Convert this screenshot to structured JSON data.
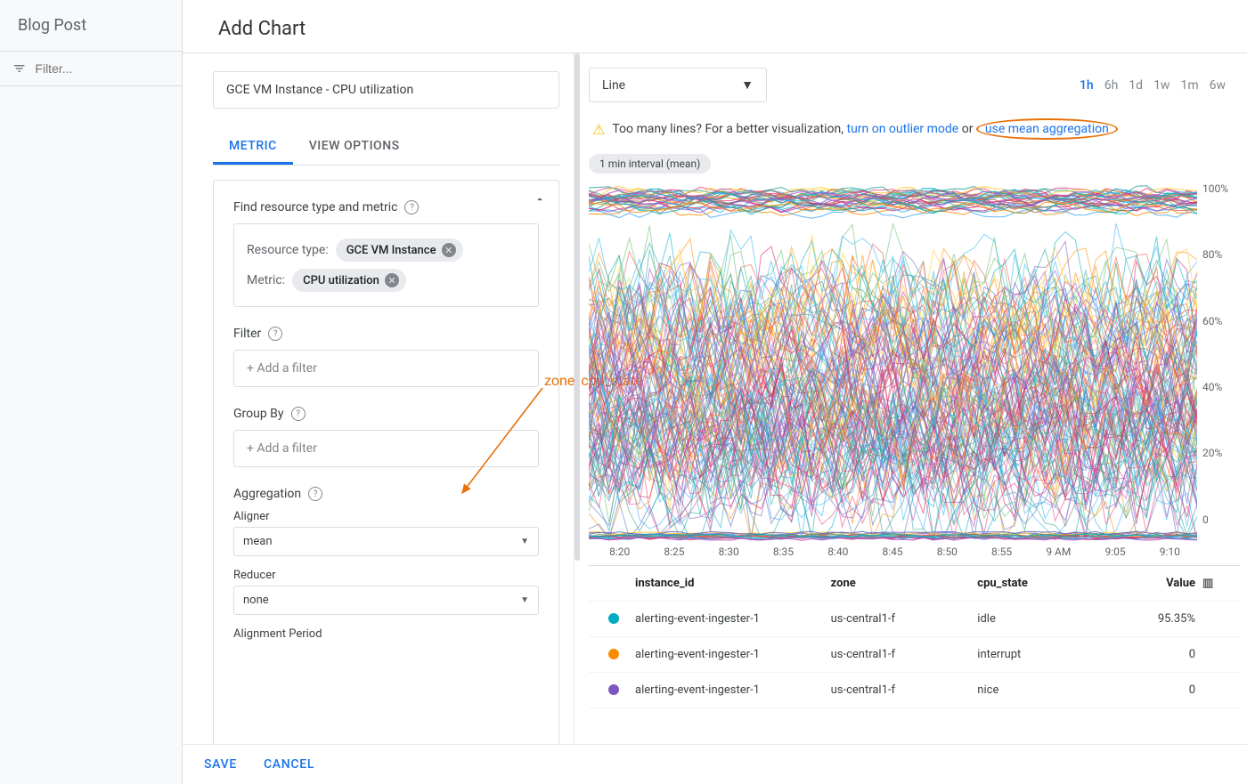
{
  "sidebar": {
    "title": "Blog Post",
    "filter_placeholder": "Filter..."
  },
  "page": {
    "title": "Add Chart"
  },
  "chart_name": "GCE VM Instance - CPU utilization",
  "tabs": {
    "metric": "METRIC",
    "view_options": "VIEW OPTIONS"
  },
  "metric": {
    "find_label": "Find resource type and metric",
    "resource_type_label": "Resource type:",
    "resource_type_value": "GCE VM Instance",
    "metric_label": "Metric:",
    "metric_value": "CPU utilization",
    "filter_label": "Filter",
    "filter_placeholder": "+ Add a filter",
    "groupby_label": "Group By",
    "groupby_placeholder": "+ Add a filter",
    "aggregation_label": "Aggregation",
    "aligner_label": "Aligner",
    "aligner_value": "mean",
    "reducer_label": "Reducer",
    "reducer_value": "none",
    "alignment_period_label": "Alignment Period"
  },
  "annotation": {
    "text": "zone, cpu_state"
  },
  "chart_type": "Line",
  "time_ranges": [
    "1h",
    "6h",
    "1d",
    "1w",
    "1m",
    "6w"
  ],
  "time_range_active": "1h",
  "warning": {
    "text_prefix": "Too many lines? For a better visualization, ",
    "link1": "turn on outlier mode",
    "middle": " or ",
    "link2": "use mean aggregation"
  },
  "interval_label": "1 min interval (mean)",
  "chart_data": {
    "type": "line",
    "ylabel": "",
    "ylim": [
      0,
      100
    ],
    "yticks": [
      "100%",
      "80%",
      "60%",
      "40%",
      "20%",
      "0"
    ],
    "xticks": [
      "8:20",
      "8:25",
      "8:30",
      "8:35",
      "8:40",
      "8:45",
      "8:50",
      "8:55",
      "9 AM",
      "9:05",
      "9:10"
    ],
    "note": "hundreds of series; values densely span 0–100% with clusters near 20–60% and near 95–100%"
  },
  "table": {
    "headers": {
      "instance_id": "instance_id",
      "zone": "zone",
      "cpu_state": "cpu_state",
      "value": "Value"
    },
    "rows": [
      {
        "color": "#00acc1",
        "instance_id": "alerting-event-ingester-1",
        "zone": "us-central1-f",
        "cpu_state": "idle",
        "value": "95.35%"
      },
      {
        "color": "#fb8c00",
        "instance_id": "alerting-event-ingester-1",
        "zone": "us-central1-f",
        "cpu_state": "interrupt",
        "value": "0"
      },
      {
        "color": "#7e57c2",
        "instance_id": "alerting-event-ingester-1",
        "zone": "us-central1-f",
        "cpu_state": "nice",
        "value": "0"
      }
    ]
  },
  "footer": {
    "save": "SAVE",
    "cancel": "CANCEL"
  }
}
